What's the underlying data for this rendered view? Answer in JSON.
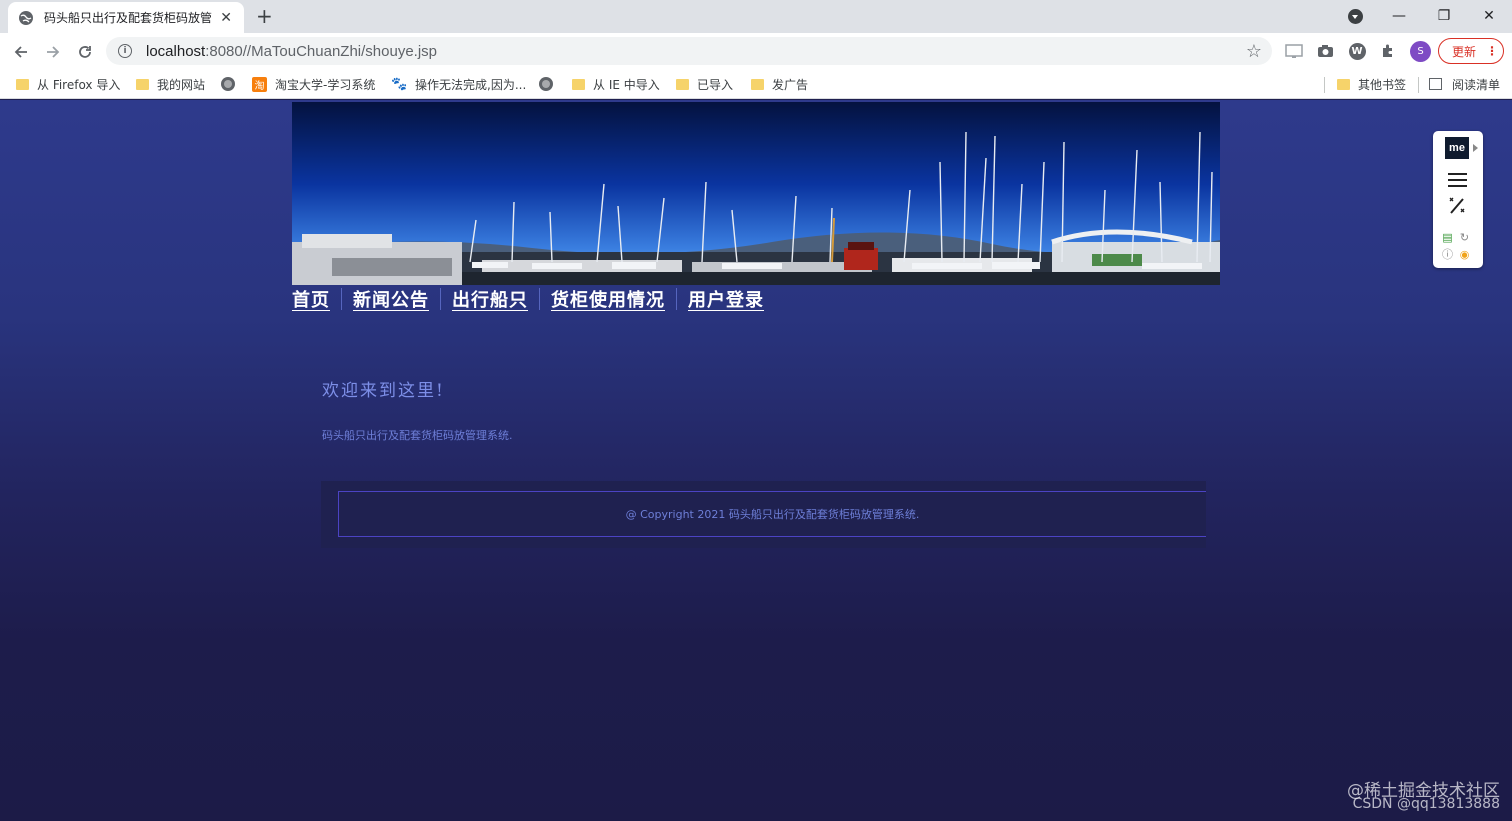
{
  "browser": {
    "tab_title": "码头船只出行及配套货柜码放管理",
    "tab_close": "✕",
    "new_tab": "+",
    "url_host": "localhost",
    "url_path": ":8080//MaTouChuanZhi/shouye.jsp",
    "update_label": "更新",
    "avatar_letter": "S",
    "win_minimize": "—",
    "win_restore": "❐",
    "win_close": "✕",
    "bookmarks": [
      {
        "label": "从 Firefox 导入",
        "icon": "folder-icon"
      },
      {
        "label": "我的网站",
        "icon": "folder-icon"
      },
      {
        "label": "",
        "icon": "globe-icon"
      },
      {
        "label": "淘宝大学-学习系统",
        "icon": "taobao-icon"
      },
      {
        "label": "操作无法完成,因为...",
        "icon": "paw-icon"
      },
      {
        "label": "",
        "icon": "globe-icon"
      },
      {
        "label": "从 IE 中导入",
        "icon": "folder-icon"
      },
      {
        "label": "已导入",
        "icon": "folder-icon"
      },
      {
        "label": "发广告",
        "icon": "folder-icon"
      }
    ],
    "other_bookmarks": "其他书签",
    "reading_list": "阅读清单"
  },
  "site": {
    "nav": [
      "首页",
      "新闻公告",
      "出行船只",
      "货柜使用情况",
      "用户登录"
    ],
    "welcome_title": "欢迎来到这里!",
    "welcome_text": "码头船只出行及配套货柜码放管理系统.",
    "footer": "@ Copyright 2021 码头船只出行及配套货柜码放管理系统."
  },
  "widget": {
    "logo": "me"
  },
  "watermark": {
    "line1": "@稀土掘金技术社区",
    "line2": "CSDN @qq13813888"
  },
  "colors": {
    "page_top": "#2e3a8c",
    "page_bottom": "#1c1b47",
    "nav_text": "#ffffff",
    "welcome_text": "#7d8fe8",
    "footer_border": "#4b43c4",
    "update_accent": "#d93025"
  }
}
